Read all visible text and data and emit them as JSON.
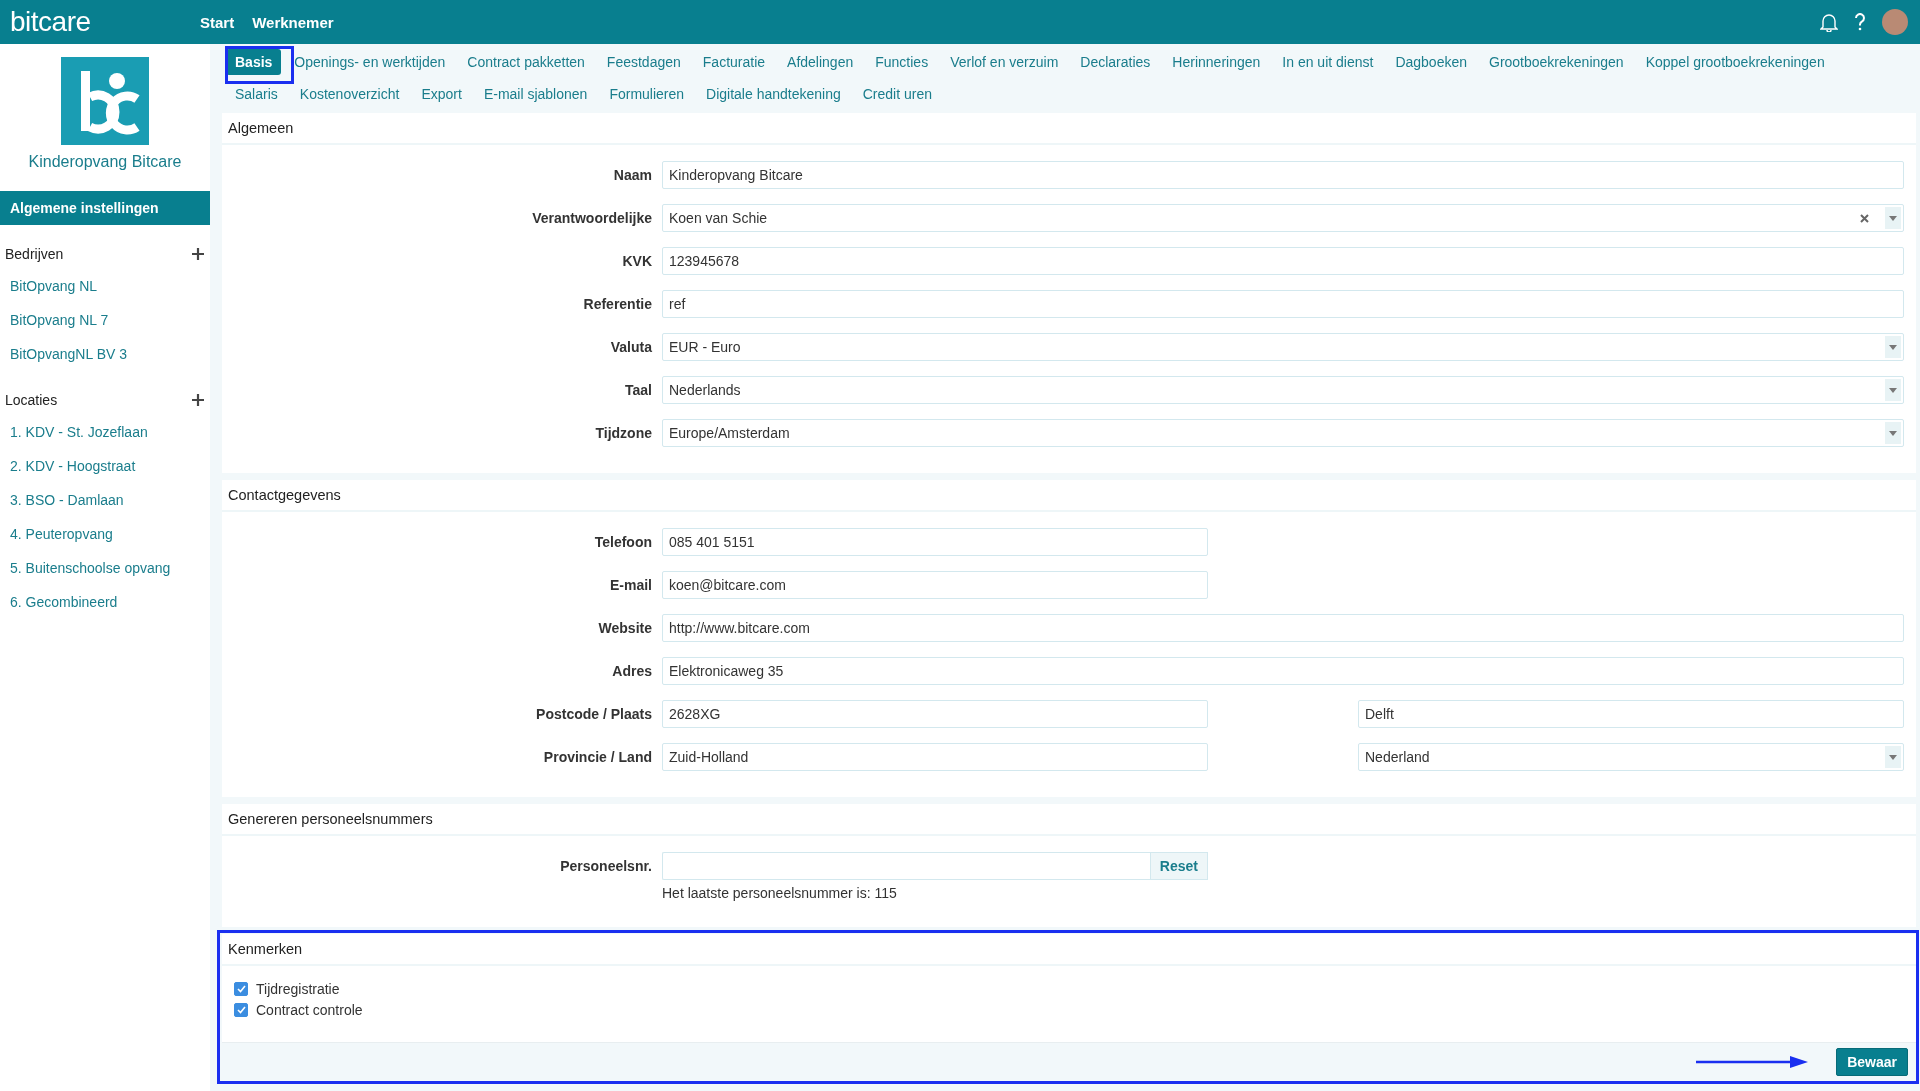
{
  "header": {
    "brand": "bitcare",
    "nav": [
      "Start",
      "Werknemer"
    ]
  },
  "sidebar": {
    "org_name": "Kinderopvang Bitcare",
    "settings_item": {
      "label": "Algemene instellingen",
      "selected": true
    },
    "groups": [
      {
        "title": "Bedrijven",
        "items": [
          "BitOpvang NL",
          "BitOpvang NL 7",
          "BitOpvangNL BV 3"
        ]
      },
      {
        "title": "Locaties",
        "items": [
          "1. KDV - St. Jozeflaan",
          "2. KDV - Hoogstraat",
          "3. BSO - Damlaan",
          "4. Peuteropvang",
          "5. Buitenschoolse opvang",
          "6. Gecombineerd"
        ]
      }
    ]
  },
  "tab_rows": [
    [
      {
        "label": "Basis",
        "selected": true
      },
      {
        "label": "Openings- en werktijden",
        "selected": false
      },
      {
        "label": "Contract pakketten",
        "selected": false
      },
      {
        "label": "Feestdagen",
        "selected": false
      },
      {
        "label": "Facturatie",
        "selected": false
      },
      {
        "label": "Afdelingen",
        "selected": false
      },
      {
        "label": "Functies",
        "selected": false
      },
      {
        "label": "Verlof en verzuim",
        "selected": false
      },
      {
        "label": "Declaraties",
        "selected": false
      },
      {
        "label": "Herinneringen",
        "selected": false
      },
      {
        "label": "In en uit dienst",
        "selected": false
      },
      {
        "label": "Dagboeken",
        "selected": false
      },
      {
        "label": "Grootboekrekeningen",
        "selected": false
      },
      {
        "label": "Koppel grootboekrekeningen",
        "selected": false
      }
    ],
    [
      {
        "label": "Salaris",
        "selected": false
      },
      {
        "label": "Kostenoverzicht",
        "selected": false
      },
      {
        "label": "Export",
        "selected": false
      },
      {
        "label": "E-mail sjablonen",
        "selected": false
      },
      {
        "label": "Formulieren",
        "selected": false
      },
      {
        "label": "Digitale handtekening",
        "selected": false
      },
      {
        "label": "Credit uren",
        "selected": false
      }
    ]
  ],
  "sections": [
    {
      "title": "Algemeen",
      "fields": [
        {
          "label": "Naam",
          "inputs": [
            {
              "kind": "text",
              "value": "Kinderopvang Bitcare"
            }
          ]
        },
        {
          "label": "Verantwoordelijke",
          "inputs": [
            {
              "kind": "clearable_select",
              "value": "Koen van Schie"
            }
          ]
        },
        {
          "label": "KVK",
          "inputs": [
            {
              "kind": "text",
              "value": "123945678"
            }
          ]
        },
        {
          "label": "Referentie",
          "inputs": [
            {
              "kind": "text",
              "value": "ref"
            }
          ]
        },
        {
          "label": "Valuta",
          "inputs": [
            {
              "kind": "select",
              "value": "EUR - Euro"
            }
          ]
        },
        {
          "label": "Taal",
          "inputs": [
            {
              "kind": "select",
              "value": "Nederlands"
            }
          ]
        },
        {
          "label": "Tijdzone",
          "inputs": [
            {
              "kind": "select",
              "value": "Europe/Amsterdam"
            }
          ]
        }
      ]
    },
    {
      "title": "Contactgegevens",
      "fields": [
        {
          "label": "Telefoon",
          "inputs": [
            {
              "kind": "short_text",
              "value": "085 401 5151"
            }
          ]
        },
        {
          "label": "E-mail",
          "inputs": [
            {
              "kind": "short_text",
              "value": "koen@bitcare.com"
            }
          ]
        },
        {
          "label": "Website",
          "inputs": [
            {
              "kind": "text",
              "value": "http://www.bitcare.com"
            }
          ]
        },
        {
          "label": "Adres",
          "inputs": [
            {
              "kind": "text",
              "value": "Elektronicaweg 35"
            }
          ]
        },
        {
          "label": "Postcode / Plaats",
          "inputs": [
            {
              "kind": "short_text",
              "value": "2628XG"
            },
            {
              "kind": "short_text",
              "value": "Delft"
            }
          ]
        },
        {
          "label": "Provincie / Land",
          "inputs": [
            {
              "kind": "short_text",
              "value": "Zuid-Holland"
            },
            {
              "kind": "short_select",
              "value": "Nederland"
            }
          ]
        }
      ]
    },
    {
      "title": "Genereren personeelsnummers",
      "fields": [
        {
          "label": "Personeelsnr.",
          "inputs": [
            {
              "kind": "reset_input",
              "button": "Reset",
              "help": "Het laatste personeelsnummer is: 115"
            }
          ]
        }
      ]
    }
  ],
  "features": {
    "title": "Kenmerken",
    "checkboxes": [
      {
        "label": "Tijdregistratie",
        "checked": true
      },
      {
        "label": "Contract controle",
        "checked": true
      }
    ],
    "save_button": "Bewaar"
  }
}
